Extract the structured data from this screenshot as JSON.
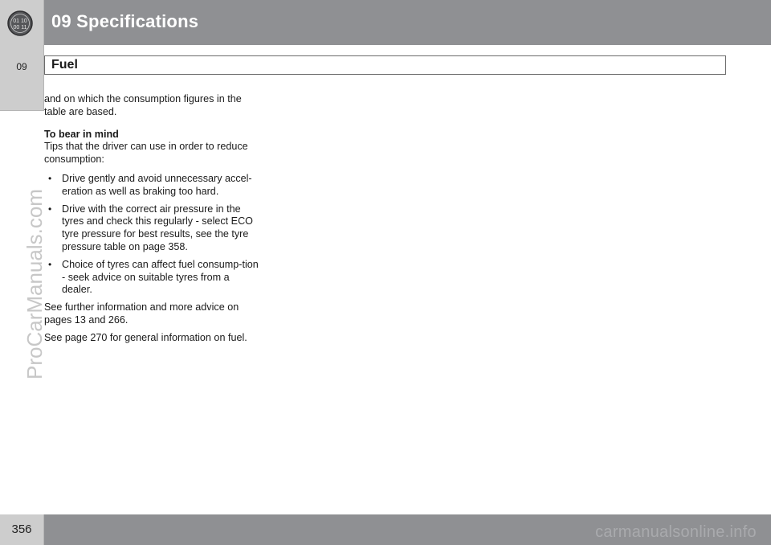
{
  "header": {
    "chapter_title": "09 Specifications",
    "section_title": "Fuel",
    "side_tab_label": "09"
  },
  "content": {
    "intro": "and on which the consumption figures in the table are based.",
    "subheading": "To bear in mind",
    "tips_intro": "Tips that the driver can use in order to reduce consumption:",
    "bullets": [
      "Drive gently and avoid unnecessary accel-eration as well as braking too hard.",
      "Drive with the correct air pressure in the tyres and check this regularly - select ECO tyre pressure for best results, see the tyre pressure table on page 358.",
      "Choice of tyres can affect fuel consump-tion - seek advice on suitable tyres from a dealer."
    ],
    "further_info": "See further information and more advice on pages 13 and 266.",
    "general_info": "See page 270 for general information on fuel."
  },
  "bullet_symbol": "•",
  "footer": {
    "page_number": "356",
    "site": "carmanualsonline.info"
  },
  "watermark": "ProCarManuals.com",
  "icons": {
    "logo": "chapter-logo-icon"
  },
  "colors": {
    "header_bar": "#8f9093",
    "side_tab": "#cdcdcd"
  }
}
